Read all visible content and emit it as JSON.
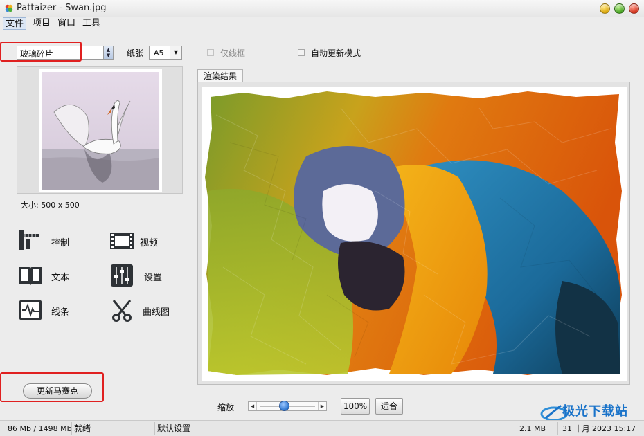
{
  "window": {
    "title": "Pattaizer - Swan.jpg"
  },
  "menu": {
    "file": "文件",
    "project": "项目",
    "window": "窗口",
    "tools": "工具"
  },
  "toolbar": {
    "style_value": "玻璃碎片",
    "paper_label": "纸张",
    "paper_value": "A5",
    "lines_only_label": "仅线框",
    "lines_only_checked": false,
    "lines_only_enabled": false,
    "auto_update_label": "自动更新模式",
    "auto_update_checked": false
  },
  "preview": {
    "size_text": "大小: 500 x 500"
  },
  "tools": [
    {
      "label": "控制",
      "icon": "ruler-icon"
    },
    {
      "label": "视频",
      "icon": "film-icon"
    },
    {
      "label": "文本",
      "icon": "book-icon"
    },
    {
      "label": "设置",
      "icon": "sliders-icon"
    },
    {
      "label": "线条",
      "icon": "waveform-icon"
    },
    {
      "label": "曲线图",
      "icon": "scissors-icon"
    }
  ],
  "update_button": "更新马赛克",
  "render": {
    "tab_label": "渲染结果"
  },
  "zoom": {
    "label": "缩放",
    "level": 0.45,
    "btn_100": "100%",
    "btn_fit": "适合"
  },
  "status": {
    "memory": "86 Mb / 1498 Mb",
    "state": "就绪",
    "preset": "默认设置",
    "file_size": "2.1 MB",
    "date": "31 十月 2023   15:17"
  },
  "watermark": {
    "text": "极光下载站"
  },
  "colors": {
    "highlight_box": "#e02020",
    "menu_active_bg": "#dbe6f4"
  }
}
